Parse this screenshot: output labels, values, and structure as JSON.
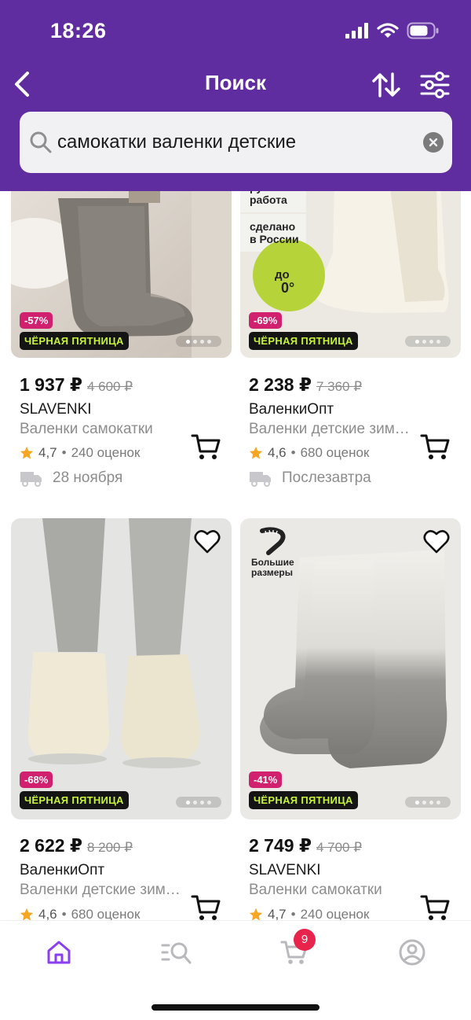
{
  "status": {
    "time": "18:26"
  },
  "nav": {
    "title": "Поиск"
  },
  "search": {
    "value": "самокатки валенки детские",
    "placeholder": ""
  },
  "colors": {
    "header": "#5f2da0",
    "discount": "#d0206e",
    "badge_text": "#c6f33a",
    "accent": "#8a3ff0",
    "star": "#f5a623"
  },
  "products": [
    {
      "discount": "-57%",
      "badge": "ЧЁРНАЯ ПЯТНИЦА",
      "price": "1 937 ₽",
      "old_price": "4 600 ₽",
      "brand": "SLAVENKI",
      "name": "Валенки самокатки",
      "rating": "4,7",
      "reviews": "240 оценок",
      "delivery": "28 ноября",
      "image_captions": []
    },
    {
      "discount": "-69%",
      "badge": "ЧЁРНАЯ ПЯТНИЦА",
      "price": "2 238 ₽",
      "old_price": "7 360 ₽",
      "brand": "ВаленкиОпт",
      "name": "Валенки детские зимние",
      "rating": "4,6",
      "reviews": "680 оценок",
      "delivery": "Послезавтра",
      "image_captions": [
        "ручная работа",
        "сделано в России",
        "до",
        "0°"
      ]
    },
    {
      "discount": "-68%",
      "badge": "ЧЁРНАЯ ПЯТНИЦА",
      "price": "2 622 ₽",
      "old_price": "8 200 ₽",
      "brand": "ВаленкиОпт",
      "name": "Валенки детские зимние",
      "rating": "4,6",
      "reviews": "680 оценок",
      "image_captions": []
    },
    {
      "discount": "-41%",
      "badge": "ЧЁРНАЯ ПЯТНИЦА",
      "price": "2 749 ₽",
      "old_price": "4 700 ₽",
      "brand": "SLAVENKI",
      "name": "Валенки самокатки",
      "rating": "4,7",
      "reviews": "240 оценок",
      "image_captions": [
        "Большие размеры"
      ]
    }
  ],
  "tabbar": {
    "cart_count": "9",
    "tabs": [
      "home-icon",
      "catalog-search-icon",
      "cart-icon",
      "profile-icon"
    ]
  }
}
